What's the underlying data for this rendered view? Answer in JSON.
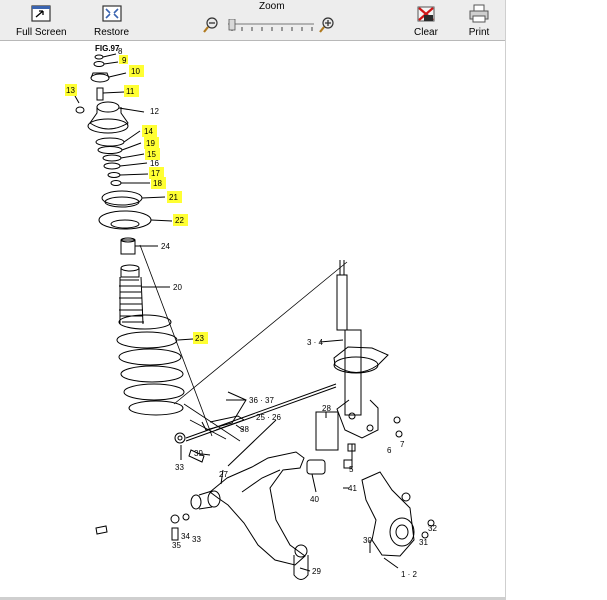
{
  "toolbar": {
    "full_screen": "Full Screen",
    "restore": "Restore",
    "zoom": "Zoom",
    "clear": "Clear",
    "print": "Print"
  },
  "figure": {
    "title": "FIG.97",
    "highlight_color": "#ffff33",
    "callouts": {
      "c8": "8",
      "c9": "9",
      "c10": "10",
      "c11": "11",
      "c12": "12",
      "c13": "13",
      "c14": "14",
      "c15": "15",
      "c16": "16",
      "c17": "17",
      "c18": "18",
      "c19": "19",
      "c20": "20",
      "c21": "21",
      "c22": "22",
      "c23": "23",
      "c24": "24",
      "c3_4": "3 · 4",
      "c36_37": "36 · 37",
      "c25_26": "25 · 26",
      "c28": "28",
      "c38": "38",
      "c39": "39",
      "c33a": "33",
      "c27": "27",
      "c5": "5",
      "c6": "6",
      "c7": "7",
      "c40": "40",
      "c41": "41",
      "c34": "34",
      "c33b": "33",
      "c35": "35",
      "c29": "29",
      "c30": "30",
      "c31": "31",
      "c32": "32",
      "c1_2": "1 · 2"
    }
  }
}
